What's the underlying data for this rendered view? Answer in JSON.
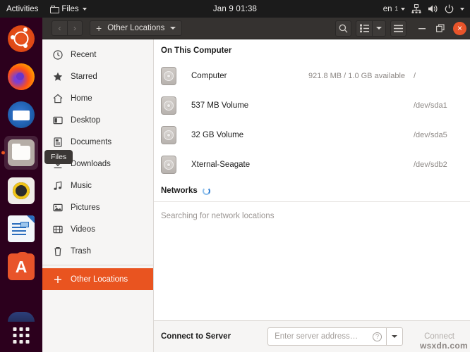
{
  "topbar": {
    "activities": "Activities",
    "app_name": "Files",
    "app_icon": "folder-icon",
    "clock": "Jan 9  01:38",
    "language": "en",
    "language_sub": "1",
    "icons": [
      "network-icon",
      "volume-icon",
      "power-icon",
      "chevron-down-icon"
    ]
  },
  "dock": {
    "items": [
      {
        "name": "ubuntu-logo-icon",
        "label": "Ubuntu"
      },
      {
        "name": "firefox-icon",
        "label": "Firefox"
      },
      {
        "name": "thunderbird-icon",
        "label": "Thunderbird"
      },
      {
        "name": "files-icon",
        "label": "Files",
        "active": true
      },
      {
        "name": "rhythmbox-icon",
        "label": "Rhythmbox"
      },
      {
        "name": "libreoffice-writer-icon",
        "label": "LibreOffice Writer"
      },
      {
        "name": "ubuntu-software-icon",
        "label": "Ubuntu Software"
      },
      {
        "name": "help-icon",
        "label": "Help"
      }
    ],
    "show_apps_label": "Show Applications"
  },
  "window": {
    "header": {
      "back_label": "‹",
      "forward_label": "›",
      "path_plus": "+",
      "path_label": "Other Locations",
      "search_icon": "search-icon",
      "view_icon": "list-view-icon",
      "view_caret": "chevron-down-icon",
      "menu_icon": "hamburger-menu-icon",
      "minimize_label": "–",
      "maximize_icon": "maximize-icon",
      "close_label": "×"
    },
    "tooltip": "Files"
  },
  "sidebar": {
    "items": [
      {
        "label": "Recent",
        "icon": "clock-icon"
      },
      {
        "label": "Starred",
        "icon": "star-icon"
      },
      {
        "label": "Home",
        "icon": "home-icon"
      },
      {
        "label": "Desktop",
        "icon": "desktop-icon"
      },
      {
        "label": "Documents",
        "icon": "document-icon"
      },
      {
        "label": "Downloads",
        "icon": "download-icon"
      },
      {
        "label": "Music",
        "icon": "music-note-icon"
      },
      {
        "label": "Pictures",
        "icon": "picture-icon"
      },
      {
        "label": "Videos",
        "icon": "video-icon"
      },
      {
        "label": "Trash",
        "icon": "trash-icon"
      }
    ],
    "other_locations": {
      "label": "Other Locations",
      "icon": "plus-icon",
      "selected": true
    }
  },
  "content": {
    "section_computer": "On This Computer",
    "drives": [
      {
        "name": "Computer",
        "free": "921.8 MB / 1.0 GB available",
        "mount": "/",
        "icon": "drive-icon"
      },
      {
        "name": "537 MB Volume",
        "free": "",
        "mount": "/dev/sda1",
        "icon": "drive-icon"
      },
      {
        "name": "32 GB Volume",
        "free": "",
        "mount": "/dev/sda5",
        "icon": "drive-icon"
      },
      {
        "name": "Xternal-Seagate",
        "free": "",
        "mount": "/dev/sdb2",
        "icon": "drive-icon"
      }
    ],
    "section_networks": "Networks",
    "networks_spinner": "loading-spinner-icon",
    "networks_status": "Searching for network locations"
  },
  "connect_bar": {
    "label": "Connect to Server",
    "placeholder": "Enter server address…",
    "help_icon": "help-icon",
    "dropdown_icon": "chevron-down-icon",
    "button_label": "Connect"
  },
  "watermark": "wsxdn.com",
  "colors": {
    "accent_orange": "#e95420",
    "headerbar": "#353230",
    "sidebar_bg": "#f6f5f4",
    "spinner_blue": "#2f7fd4"
  }
}
